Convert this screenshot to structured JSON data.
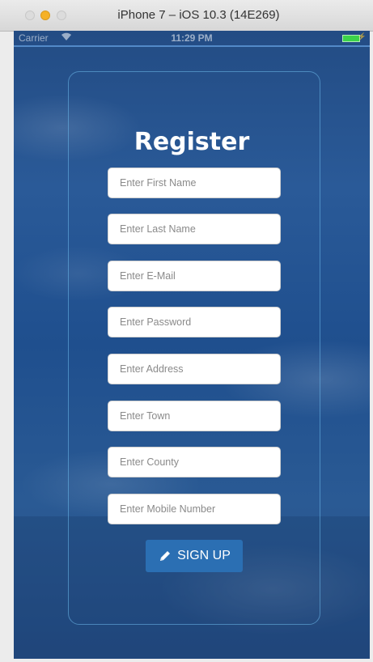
{
  "window": {
    "title": "iPhone 7 – iOS 10.3 (14E269)"
  },
  "status_bar": {
    "carrier": "Carrier",
    "time": "11:29 PM"
  },
  "form": {
    "title": "Register",
    "fields": [
      {
        "placeholder": "Enter First Name",
        "value": ""
      },
      {
        "placeholder": "Enter Last Name",
        "value": ""
      },
      {
        "placeholder": "Enter E-Mail",
        "value": ""
      },
      {
        "placeholder": "Enter Password",
        "value": ""
      },
      {
        "placeholder": "Enter Address",
        "value": ""
      },
      {
        "placeholder": "Enter Town",
        "value": ""
      },
      {
        "placeholder": "Enter County",
        "value": ""
      },
      {
        "placeholder": "Enter Mobile Number",
        "value": ""
      }
    ],
    "submit_label": "SIGN UP"
  },
  "colors": {
    "background": "#2a5a98",
    "button": "#2b6fb3",
    "battery": "#3cd34a"
  },
  "icons": {
    "submit": "pencil-icon",
    "wifi": "wifi-icon",
    "battery": "battery-icon"
  }
}
